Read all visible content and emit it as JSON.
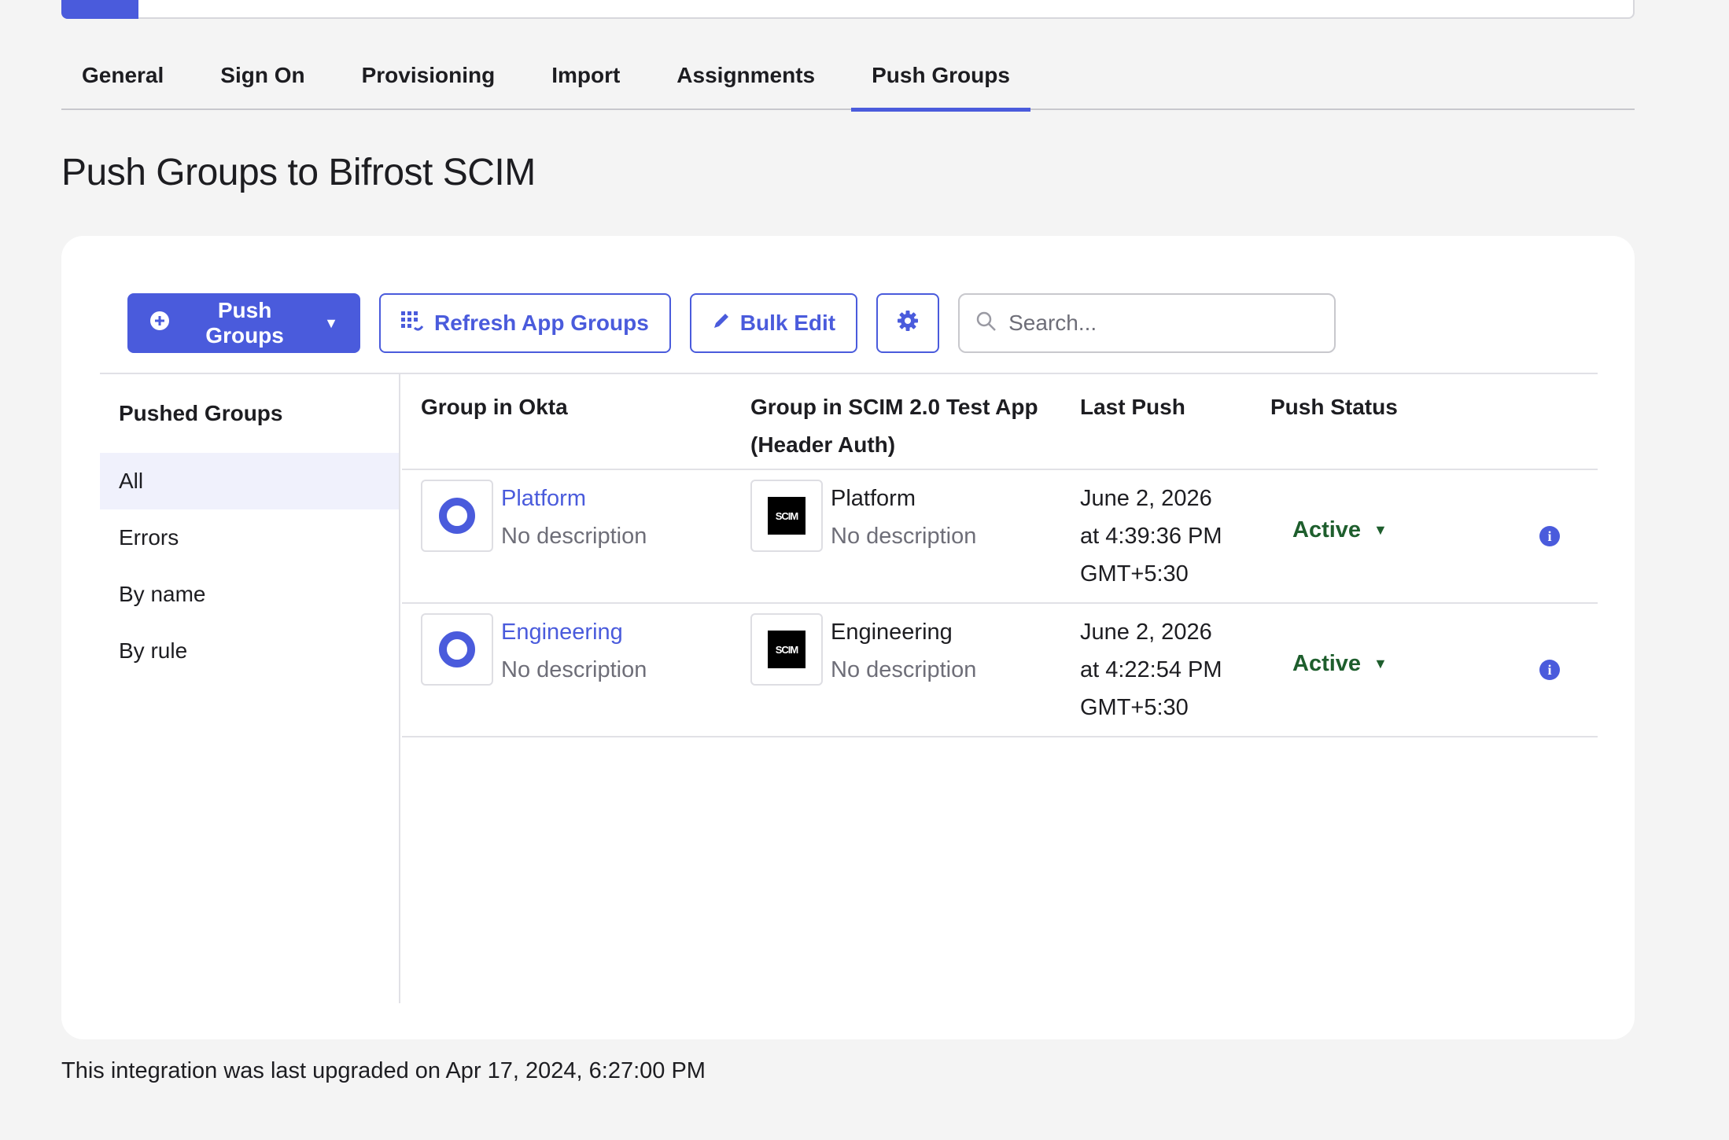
{
  "tabs": [
    {
      "label": "General"
    },
    {
      "label": "Sign On"
    },
    {
      "label": "Provisioning"
    },
    {
      "label": "Import"
    },
    {
      "label": "Assignments"
    },
    {
      "label": "Push Groups"
    }
  ],
  "active_tab": "Push Groups",
  "page_title": "Push Groups to Bifrost SCIM",
  "toolbar": {
    "push_groups_label": "Push Groups",
    "refresh_label": "Refresh App Groups",
    "bulk_edit_label": "Bulk Edit",
    "search_placeholder": "Search..."
  },
  "filters": {
    "title": "Pushed Groups",
    "items": [
      {
        "label": "All"
      },
      {
        "label": "Errors"
      },
      {
        "label": "By name"
      },
      {
        "label": "By rule"
      }
    ]
  },
  "table": {
    "headers": {
      "okta_group": "Group in Okta",
      "app_group_line1": "Group in SCIM 2.0 Test App",
      "app_group_line2": "(Header Auth)",
      "last_push": "Last Push",
      "push_status": "Push Status"
    },
    "rows": [
      {
        "okta_name": "Platform",
        "okta_desc": "No description",
        "app_name": "Platform",
        "app_desc": "No description",
        "logo_text": "SCIM",
        "date_line1": "June 2, 2026",
        "date_line2": "at 4:39:36 PM",
        "date_line3": "GMT+5:30",
        "status": "Active"
      },
      {
        "okta_name": "Engineering",
        "okta_desc": "No description",
        "app_name": "Engineering",
        "app_desc": "No description",
        "logo_text": "SCIM",
        "date_line1": "June 2, 2026",
        "date_line2": "at 4:22:54 PM",
        "date_line3": "GMT+5:30",
        "status": "Active"
      }
    ]
  },
  "footer_note": "This integration was last upgraded on Apr 17, 2024, 6:27:00 PM",
  "colors": {
    "accent": "#4a5bdc",
    "status_active": "#1e5e2d",
    "background": "#f4f4f4"
  },
  "icons": {
    "push_groups": "plus-circle-icon",
    "refresh": "grid-refresh-icon",
    "bulk_edit": "pencil-icon",
    "settings": "gear-icon",
    "search": "search-icon",
    "info": "info-icon",
    "okta_group": "okta-ring-icon"
  }
}
